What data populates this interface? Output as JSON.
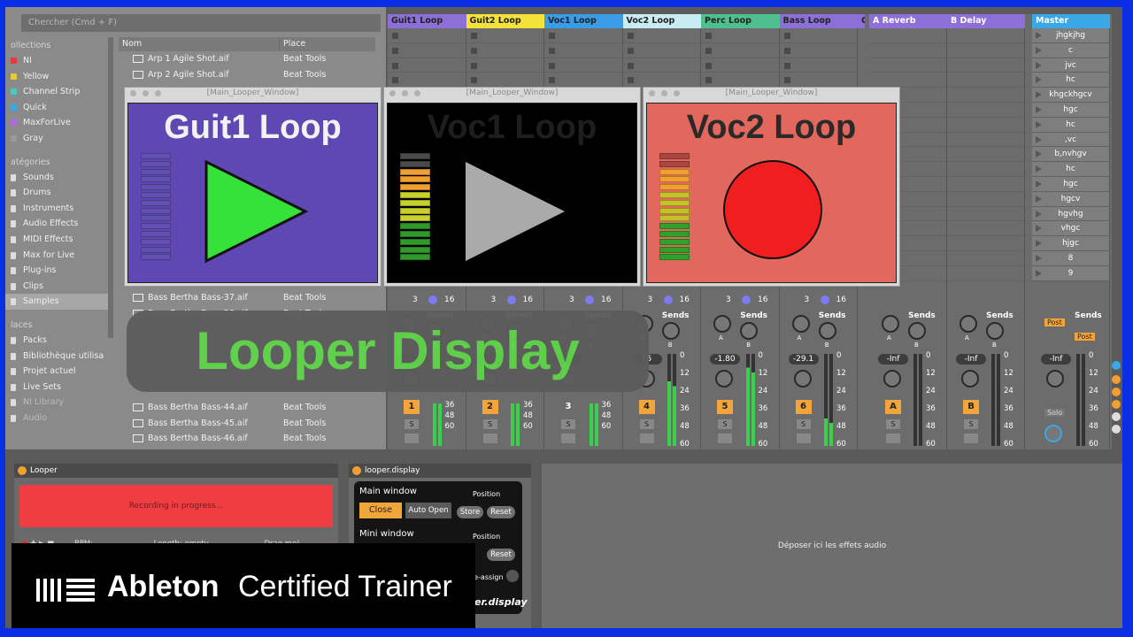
{
  "browser": {
    "search_placeholder": "Chercher (Cmd + F)",
    "collections_label": "ollections",
    "collections": [
      {
        "label": "NI",
        "color": "#e13b3b"
      },
      {
        "label": "Yellow",
        "color": "#e6c93a"
      },
      {
        "label": "Channel Strip",
        "color": "#4ec7c0"
      },
      {
        "label": "Quick",
        "color": "#3aa7e6"
      },
      {
        "label": "MaxForLive",
        "color": "#b06be0"
      },
      {
        "label": "Gray",
        "color": "#9a9a9a"
      }
    ],
    "categories_label": "atégories",
    "categories": [
      "Sounds",
      "Drums",
      "Instruments",
      "Audio Effects",
      "MIDI Effects",
      "Max for Live",
      "Plug-ins",
      "Clips",
      "Samples"
    ],
    "places_label": "laces",
    "places": [
      "Packs",
      "Bibliothèque utilisa",
      "Projet actuel",
      "Live Sets",
      "NI Library",
      "Audio"
    ],
    "columns": {
      "name": "Nom",
      "place": "Place"
    },
    "files_top": [
      {
        "name": "Arp 1 Agile Shot.aif",
        "place": "Beat Tools"
      },
      {
        "name": "Arp 2 Agile Shot.aif",
        "place": "Beat Tools"
      }
    ],
    "files_mid": [
      {
        "name": "Bass Bertha Bass-37.aif",
        "place": "Beat Tools"
      },
      {
        "name": "Bass Bertha Bass-38.aif",
        "place": "Beat Tools"
      }
    ],
    "files_bottom": [
      {
        "name": "Bass Bertha Bass-44.aif",
        "place": "Beat Tools"
      },
      {
        "name": "Bass Bertha Bass-45.aif",
        "place": "Beat Tools"
      },
      {
        "name": "Bass Bertha Bass-46.aif",
        "place": "Beat Tools"
      }
    ]
  },
  "tracks": [
    {
      "label": "Guit1 Loop",
      "color": "#8d6fd8",
      "num": "1"
    },
    {
      "label": "Guit2 Loop",
      "color": "#f2e23a",
      "num": "2"
    },
    {
      "label": "Voc1 Loop",
      "color": "#3a9be6",
      "num": "3"
    },
    {
      "label": "Voc2 Loop",
      "color": "#c9ecf2",
      "num": "4"
    },
    {
      "label": "Perc Loop",
      "color": "#4fbf8f",
      "num": "5"
    },
    {
      "label": "Bass Loop",
      "color": "#8d6fd8",
      "num": "6"
    },
    {
      "label": "G",
      "color": "#8d6fd8",
      "num": ""
    }
  ],
  "returns": [
    {
      "label": "A Reverb",
      "color": "#8d6fd8",
      "num": "A"
    },
    {
      "label": "B Delay",
      "color": "#8d6fd8",
      "num": "B"
    }
  ],
  "master": {
    "label": "Master",
    "color": "#3aa7e6",
    "scenes": [
      "jhgkjhg",
      "c",
      "jvc",
      "hc",
      "khgckhgcv",
      "hgc",
      "hc",
      ",vc",
      "b,nvhgv",
      "hc",
      "hgc",
      "hgcv",
      "hgvhg",
      "vhgc",
      "hjgc",
      "8",
      "9"
    ],
    "solo": "Solo"
  },
  "mixer": {
    "io_a": "3",
    "io_b": "16",
    "sends": "Sends",
    "knob_a": "A",
    "knob_b": "B",
    "post": "Post",
    "s": "S",
    "volumes": [
      "-1.80",
      "-29.1"
    ],
    "vol_partial": "75",
    "inf": "-Inf",
    "scale": [
      "0",
      "12",
      "24",
      "36",
      "48",
      "60"
    ],
    "scale_low": [
      "36",
      "48",
      "60"
    ]
  },
  "looper_windows": [
    {
      "title_bar": "[Main_Looper_Window]",
      "label": "Guit1 Loop",
      "bg": "#5f48b3",
      "text_color": "#f2f2f2",
      "state": "play"
    },
    {
      "title_bar": "[Main_Looper_Window]",
      "label": "Voc1 Loop",
      "bg": "#000000",
      "text_color": "#1e1e1e",
      "state": "idle"
    },
    {
      "title_bar": "[Main_Looper_Window]",
      "label": "Voc2 Loop",
      "bg": "#e2675d",
      "text_color": "#2a2a2a",
      "state": "record"
    }
  ],
  "overlay_title": "Looper Display",
  "looper_device": {
    "title": "Looper",
    "status": "Recording in progress...",
    "bpm": "BPM: -",
    "length": "Length: empty",
    "drag": "Drag me!"
  },
  "display_device": {
    "title": "looper.display",
    "main_window": "Main window",
    "close": "Close",
    "auto_open": "Auto Open",
    "position": "Position",
    "store": "Store",
    "reset": "Reset",
    "mini_window": "Mini window",
    "reassign": "re-assign",
    "footer": "er.display"
  },
  "drop_zone": "Déposer ici les effets audio",
  "brand": {
    "name": "Ableton",
    "subtitle": "Certified Trainer"
  }
}
